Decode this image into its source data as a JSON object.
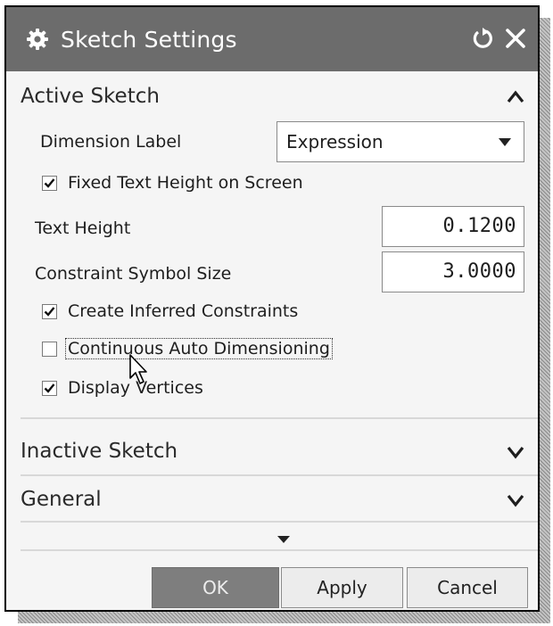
{
  "dialog": {
    "title": "Sketch Settings",
    "title_icon": "gear-icon",
    "reset_icon": "reset-icon",
    "close_icon": "close-icon"
  },
  "active_sketch": {
    "header": "Active Sketch",
    "expanded": true,
    "dimension_label": {
      "label": "Dimension Label",
      "value": "Expression"
    },
    "fixed_text_height": {
      "label": "Fixed Text Height on Screen",
      "checked": true
    },
    "text_height": {
      "label": "Text Height",
      "value": "0.1200"
    },
    "constraint_symbol_size": {
      "label": "Constraint Symbol Size",
      "value": "3.0000"
    },
    "create_inferred": {
      "label": "Create Inferred Constraints",
      "checked": true
    },
    "continuous_auto_dim": {
      "label": "Continuous Auto Dimensioning",
      "checked": false
    },
    "display_vertices": {
      "label": "Display Vertices",
      "checked": true
    }
  },
  "inactive_sketch": {
    "header": "Inactive Sketch",
    "expanded": false
  },
  "general": {
    "header": "General",
    "expanded": false
  },
  "buttons": {
    "ok": "OK",
    "apply": "Apply",
    "cancel": "Cancel"
  }
}
